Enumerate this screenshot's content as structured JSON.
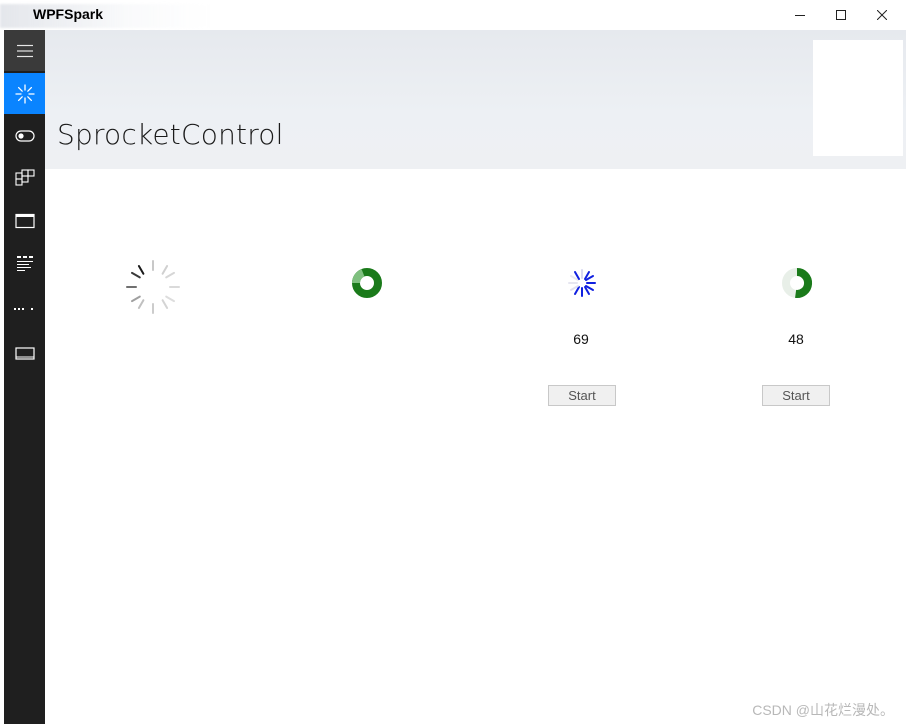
{
  "window": {
    "title": "WPFSpark",
    "controls": [
      "minimize-icon",
      "maximize-icon",
      "close-icon"
    ]
  },
  "sidebar": {
    "items": [
      {
        "name": "hamburger",
        "icon": "hamburger-icon"
      },
      {
        "name": "sprocket",
        "icon": "sprocket-icon",
        "active": true
      },
      {
        "name": "toggle",
        "icon": "toggle-switch-icon"
      },
      {
        "name": "fluidwrap",
        "icon": "fluid-wrap-icon"
      },
      {
        "name": "window",
        "icon": "window-icon"
      },
      {
        "name": "sprocket-list",
        "icon": "list-lines-icon"
      },
      {
        "name": "progress",
        "icon": "dots-icon"
      },
      {
        "name": "panel",
        "icon": "panel-icon"
      }
    ],
    "colors": {
      "background": "#1f1f1f",
      "active": "#0a84ff",
      "hamburger_bg": "#3a3a3a"
    }
  },
  "header": {
    "title": "SprocketControl"
  },
  "sprockets": [
    {
      "name": "indeterminate-gray",
      "color": "#222222",
      "style": "spokes"
    },
    {
      "name": "ring-green",
      "color": "#1a7a1a",
      "style": "ring"
    },
    {
      "name": "progress-blue",
      "color": "#1020e0",
      "value": "69",
      "button": "Start",
      "style": "spokes-small"
    },
    {
      "name": "progress-green",
      "color": "#1a7a1a",
      "value": "48",
      "button": "Start",
      "style": "half-ring"
    }
  ],
  "watermark": "CSDN @山花烂漫处。"
}
